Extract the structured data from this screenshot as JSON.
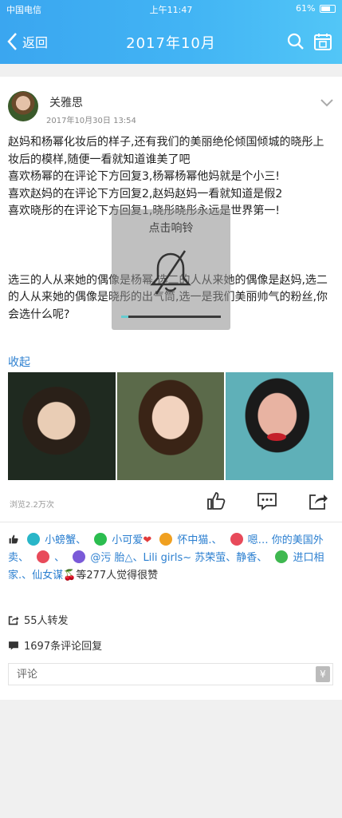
{
  "status_bar": {
    "carrier": "中国电信",
    "time": "上午11:47",
    "battery": "61%"
  },
  "nav": {
    "back_label": "返回",
    "title": "2017年10月"
  },
  "post": {
    "author": "关雅思",
    "timestamp": "2017年10月30日 13:54",
    "paragraphs": [
      "赵妈和杨幂化妆后的样子,还有我们的美丽绝伦倾国倾城的晓彤上妆后的模样,随便一看就知道谁美了吧",
      "喜欢杨幂的在评论下方回复3,杨幂杨幂他妈就是个小三!",
      "喜欢赵妈的在评论下方回复2,赵妈赵妈一看就知道是假2",
      "喜欢晓彤的在评论下方回复1,晓彤晓彤永远是世界第一!"
    ],
    "paragraph_tail": "选三的人从来她的偶像是杨幂,选二的人从来她的偶像是赵妈,选二的人从来她的偶像是晓彤的出气筒,选一是我们美丽帅气的粉丝,你会选什么呢?",
    "collapse_label": "收起",
    "views": "浏览2.2万次"
  },
  "likes": {
    "names": [
      "小螃蟹、",
      "小可爱",
      "怀中猫.、",
      "嗯…",
      "你的美国外卖、",
      "、",
      "@污 胎△、Lili girls~",
      "苏荣萤、静香、",
      "进口相家.、仙女谋"
    ],
    "summary": "等277人觉得很赞",
    "colors": [
      "#29b6c8",
      "#2bbd4f",
      "#f0a020",
      "#e84a5a",
      "#e84a5a",
      "#7a5ad8",
      "#3fb850"
    ]
  },
  "stats": {
    "shares": "55人转发",
    "comments": "1697条评论回复"
  },
  "comment_input": {
    "placeholder": "评论",
    "value": ""
  },
  "toast": {
    "label": "点击响铃",
    "progress": 0.07
  },
  "icons": [
    "back-icon",
    "search-icon",
    "calendar-icon",
    "chevron-down-icon",
    "like-icon",
    "comment-icon",
    "share-icon",
    "bell-muted-icon",
    "money-icon"
  ]
}
